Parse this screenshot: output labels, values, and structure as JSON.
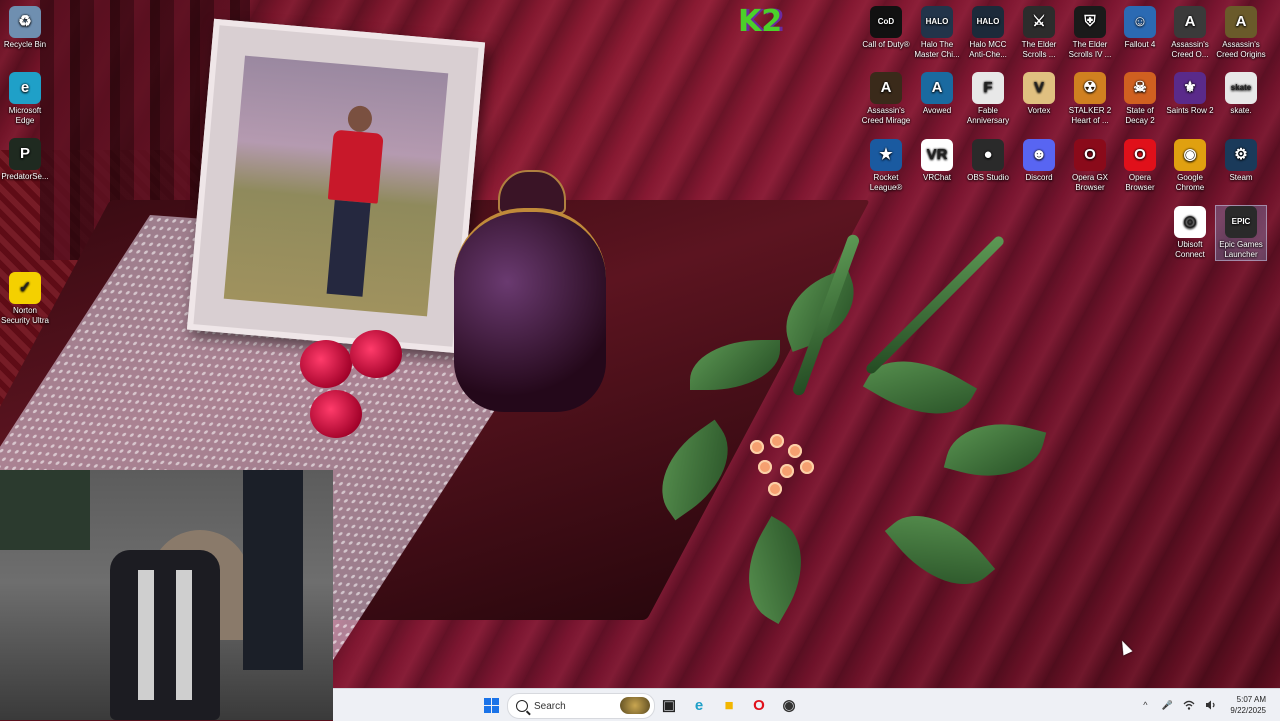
{
  "desktop": {
    "icons": [
      {
        "label": "Recycle Bin",
        "glyph": "♻",
        "color": "#6f8fb0",
        "icon": "recycle-bin-icon"
      },
      {
        "label": "Microsoft Edge",
        "glyph": "e",
        "color": "#1fa0c8",
        "icon": "edge-icon"
      },
      {
        "label": "PredatorSe...",
        "glyph": "P",
        "color": "#1f2a20",
        "icon": "predator-sense-icon"
      },
      {
        "label": "Norton Security Ultra",
        "glyph": "✓",
        "color": "#f4d000",
        "icon": "norton-icon"
      },
      {
        "label": "Call of Duty®",
        "glyph": "CoD",
        "color": "#111111",
        "icon": "call-of-duty-icon"
      },
      {
        "label": "Halo The Master Chi...",
        "glyph": "HALO",
        "color": "#22344a",
        "icon": "halo-mcc-icon"
      },
      {
        "label": "Halo MCC Anti-Che...",
        "glyph": "HALO",
        "color": "#1c2a3a",
        "icon": "halo-mcc-anticheat-icon"
      },
      {
        "label": "The Elder Scrolls ...",
        "glyph": "⚔",
        "color": "#2c2c2c",
        "icon": "elder-scrolls-icon"
      },
      {
        "label": "The Elder Scrolls IV ...",
        "glyph": "⛨",
        "color": "#1a1a1a",
        "icon": "oblivion-icon"
      },
      {
        "label": "Fallout 4",
        "glyph": "☺",
        "color": "#2b6ab3",
        "icon": "fallout-4-icon"
      },
      {
        "label": "Assassin's Creed O...",
        "glyph": "A",
        "color": "#3a3a3a",
        "icon": "ac-odyssey-icon"
      },
      {
        "label": "Assassin's Creed Origins",
        "glyph": "A",
        "color": "#6a5a2a",
        "icon": "ac-origins-icon"
      },
      {
        "label": "Assassin's Creed Mirage",
        "glyph": "A",
        "color": "#3a2a1a",
        "icon": "ac-mirage-icon"
      },
      {
        "label": "Avowed",
        "glyph": "A",
        "color": "#1a6aa0",
        "icon": "avowed-icon"
      },
      {
        "label": "Fable Anniversary",
        "glyph": "F",
        "color": "#e8e8e8",
        "icon": "fable-icon"
      },
      {
        "label": "Vortex",
        "glyph": "V",
        "color": "#e0c080",
        "icon": "vortex-icon"
      },
      {
        "label": "STALKER 2 Heart of ...",
        "glyph": "☢",
        "color": "#d08020",
        "icon": "stalker-2-icon"
      },
      {
        "label": "State of Decay 2",
        "glyph": "☠",
        "color": "#d06020",
        "icon": "state-of-decay-icon"
      },
      {
        "label": "Saints Row 2",
        "glyph": "⚜",
        "color": "#5a2a8a",
        "icon": "saints-row-icon"
      },
      {
        "label": "skate.",
        "glyph": "skate",
        "color": "#e8e8e8",
        "icon": "skate-icon"
      },
      {
        "label": "Rocket League®",
        "glyph": "★",
        "color": "#1a5aa0",
        "icon": "rocket-league-icon"
      },
      {
        "label": "VRChat",
        "glyph": "VR",
        "color": "#ffffff",
        "icon": "vrchat-icon"
      },
      {
        "label": "OBS Studio",
        "glyph": "●",
        "color": "#2a2a2a",
        "icon": "obs-icon"
      },
      {
        "label": "Discord",
        "glyph": "☻",
        "color": "#5865f2",
        "icon": "discord-icon"
      },
      {
        "label": "Opera GX Browser",
        "glyph": "O",
        "color": "#8a0a1a",
        "icon": "opera-gx-icon"
      },
      {
        "label": "Opera Browser",
        "glyph": "O",
        "color": "#e0101a",
        "icon": "opera-icon"
      },
      {
        "label": "Google Chrome",
        "glyph": "◉",
        "color": "#e0a010",
        "icon": "chrome-icon"
      },
      {
        "label": "Steam",
        "glyph": "⚙",
        "color": "#1a3a5a",
        "icon": "steam-icon"
      },
      {
        "label": "Ubisoft Connect",
        "glyph": "◎",
        "color": "#ffffff",
        "icon": "ubisoft-connect-icon"
      },
      {
        "label": "Epic Games Launcher",
        "glyph": "EPIC",
        "color": "#2a2a2a",
        "icon": "epic-games-icon"
      }
    ],
    "logo_text": "K2"
  },
  "taskbar": {
    "search_placeholder": "Search",
    "pinned": [
      {
        "name": "task-view-icon",
        "glyph": "▣",
        "color": "#222222"
      },
      {
        "name": "edge-taskbar-icon",
        "glyph": "e",
        "color": "#1fa0c8"
      },
      {
        "name": "file-explorer-icon",
        "glyph": "■",
        "color": "#f2b600"
      },
      {
        "name": "opera-taskbar-icon",
        "glyph": "O",
        "color": "#e0101a"
      },
      {
        "name": "app-taskbar-icon",
        "glyph": "◉",
        "color": "#333333"
      }
    ],
    "tray": {
      "chevron": "^",
      "time": "5:07 AM",
      "date": "9/22/2025"
    }
  }
}
